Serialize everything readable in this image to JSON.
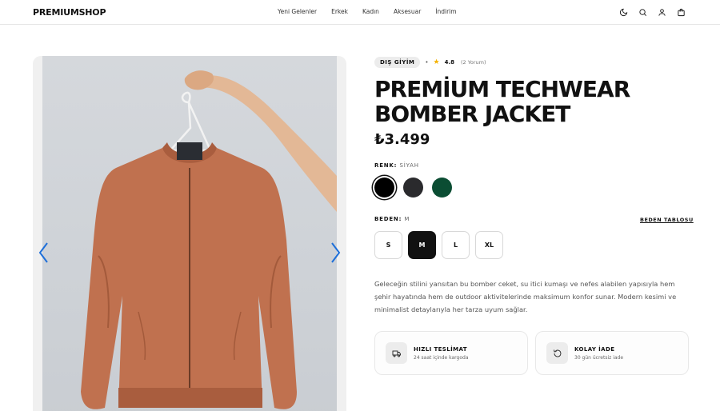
{
  "header": {
    "logo": "PREMIUMSHOP",
    "nav": [
      "Yeni Gelenler",
      "Erkek",
      "Kadın",
      "Aksesuar",
      "İndirim"
    ],
    "icons": [
      "moon-icon",
      "search-icon",
      "user-icon",
      "bag-icon"
    ]
  },
  "product": {
    "category": "DIŞ GİYİM",
    "separator": "•",
    "rating": "4.8",
    "reviews": "(2 Yorum)",
    "title": "PREMİUM TECHWEAR BOMBER JACKET",
    "price": "₺3.499",
    "color_label": "RENK:",
    "color_value": "SİYAH",
    "colors": [
      "#000000",
      "#2a2a2d",
      "#0b4d33"
    ],
    "selected_color_index": 0,
    "size_label": "BEDEN:",
    "size_value": "M",
    "size_guide": "BEDEN TABLOSU",
    "sizes": [
      "S",
      "M",
      "L",
      "XL"
    ],
    "selected_size": "M",
    "description": "Geleceğin stilini yansıtan bu bomber ceket, su itici kumaşı ve nefes alabilen yapısıyla hem şehir hayatında hem de outdoor aktivitelerinde maksimum konfor sunar. Modern kesimi ve minimalist detaylarıyla her tarza uyum sağlar."
  },
  "features": [
    {
      "icon": "truck-icon",
      "title": "HIZLI TESLİMAT",
      "subtitle": "24 saat içinde kargoda"
    },
    {
      "icon": "return-icon",
      "title": "KOLAY İADE",
      "subtitle": "30 gün ücretsiz iade"
    }
  ],
  "colors": {
    "accent": "#1e6fd9",
    "jacket": "#c0714f"
  }
}
